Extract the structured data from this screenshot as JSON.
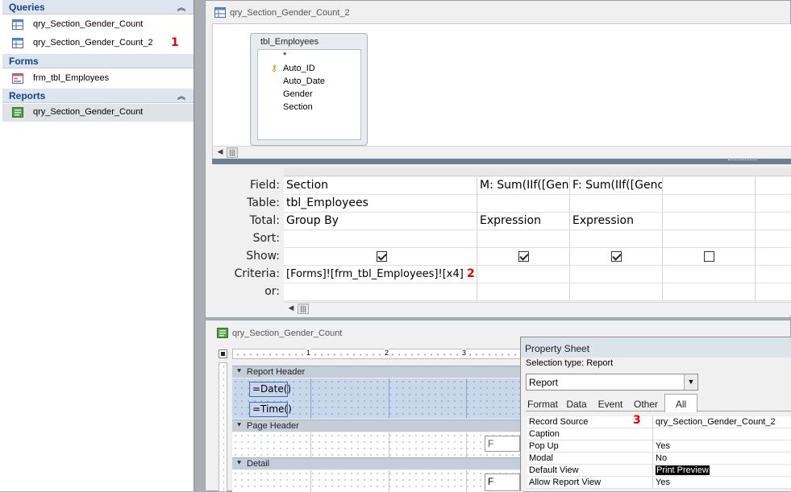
{
  "nav": {
    "groups": [
      {
        "title": "Queries",
        "items": [
          "qry_Section_Gender_Count",
          "qry_Section_Gender_Count_2"
        ]
      },
      {
        "title": "Forms",
        "items": [
          "frm_tbl_Employees"
        ]
      },
      {
        "title": "Reports",
        "items": [
          "qry_Section_Gender_Count"
        ]
      }
    ],
    "marker1": "1"
  },
  "query_window": {
    "title": "qry_Section_Gender_Count_2",
    "table": {
      "name": "tbl_Employees",
      "fields": [
        "*",
        "Auto_ID",
        "Auto_Date",
        "Gender",
        "Section"
      ]
    },
    "row_labels": [
      "Field:",
      "Table:",
      "Total:",
      "Sort:",
      "Show:",
      "Criteria:",
      "or:"
    ],
    "columns": [
      {
        "field": "Section",
        "table": "tbl_Employees",
        "total": "Group By",
        "sort": "",
        "show": true,
        "criteria": "[Forms]![frm_tbl_Employees]![x4]",
        "or": ""
      },
      {
        "field": "M: Sum(IIf([Gend",
        "table": "",
        "total": "Expression",
        "sort": "",
        "show": true,
        "criteria": "",
        "or": ""
      },
      {
        "field": "F: Sum(IIf([Gende",
        "table": "",
        "total": "Expression",
        "sort": "",
        "show": true,
        "criteria": "",
        "or": ""
      },
      {
        "field": "",
        "table": "",
        "total": "",
        "sort": "",
        "show": false,
        "criteria": "",
        "or": ""
      }
    ],
    "marker2": "2"
  },
  "report_window": {
    "title": "qry_Section_Gender_Count",
    "ruler_numbers": [
      "1",
      "2",
      "3"
    ],
    "sections": [
      "Report Header",
      "Page Header",
      "Detail"
    ],
    "controls": {
      "date": "=Date()",
      "time": "=Time()",
      "page_header_field": "F",
      "detail_field": "F"
    }
  },
  "property_sheet": {
    "title": "Property Sheet",
    "selection_type_label": "Selection type:",
    "selection_type_value": "Report",
    "combo_value": "Report",
    "tabs": [
      "Format",
      "Data",
      "Event",
      "Other",
      "All"
    ],
    "active_tab": "All",
    "properties": [
      {
        "name": "Record Source",
        "value": "qry_Section_Gender_Count_2"
      },
      {
        "name": "Caption",
        "value": ""
      },
      {
        "name": "Pop Up",
        "value": "Yes"
      },
      {
        "name": "Modal",
        "value": "No"
      },
      {
        "name": "Default View",
        "value": "Print Preview"
      },
      {
        "name": "Allow Report View",
        "value": "Yes"
      }
    ],
    "marker3": "3"
  }
}
